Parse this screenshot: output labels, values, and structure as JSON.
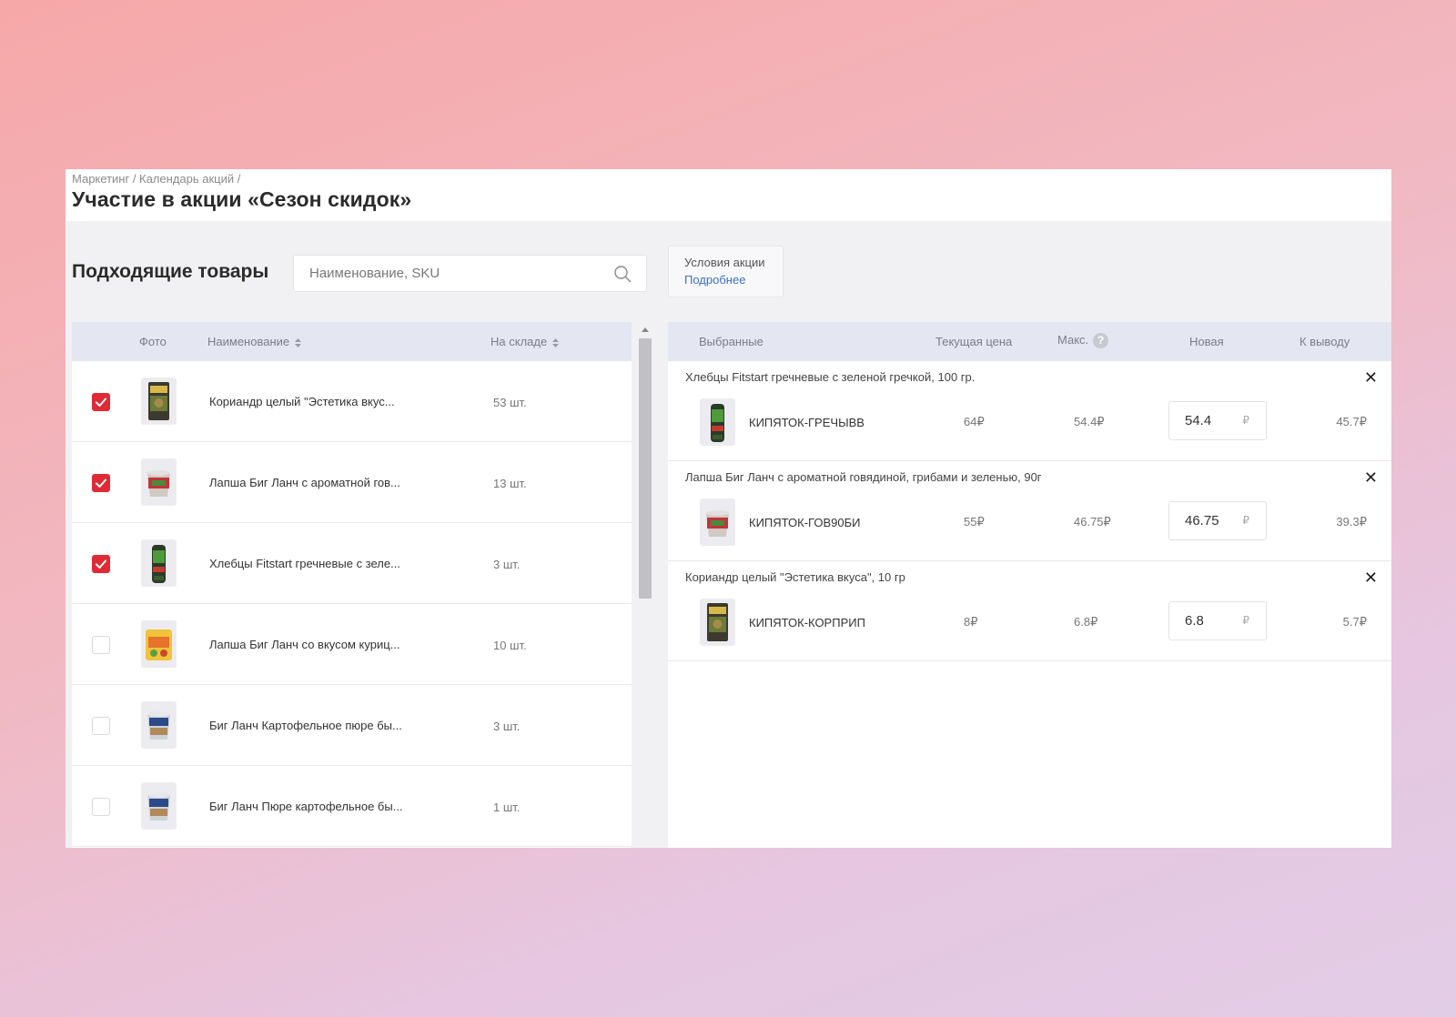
{
  "header": {
    "breadcrumb": "Маркетинг / Календарь акций /",
    "title": "Участие в акции «Сезон скидок»"
  },
  "left": {
    "section_title": "Подходящие товары",
    "search_placeholder": "Наименование, SKU",
    "columns": {
      "photo": "Фото",
      "name": "Наименование",
      "stock": "На складе"
    },
    "rows": [
      {
        "checked": true,
        "name": "Кориандр целый \"Эстетика вкус...",
        "stock": "53 шт.",
        "thumb": "coriander"
      },
      {
        "checked": true,
        "name": "Лапша Биг Ланч с ароматной гов...",
        "stock": "13 шт.",
        "thumb": "cup-red"
      },
      {
        "checked": true,
        "name": "Хлебцы Fitstart гречневые с зеле...",
        "stock": "3 шт.",
        "thumb": "bread"
      },
      {
        "checked": false,
        "name": "Лапша Биг Ланч со вкусом куриц...",
        "stock": "10 шт.",
        "thumb": "noodle-pack"
      },
      {
        "checked": false,
        "name": "Биг Ланч Картофельное пюре бы...",
        "stock": "3 шт.",
        "thumb": "cup-blue"
      },
      {
        "checked": false,
        "name": "Биг Ланч Пюре картофельное бы...",
        "stock": "1 шт.",
        "thumb": "cup-blue"
      }
    ]
  },
  "promo": {
    "line1": "Условия акции",
    "line2": "Подробнее"
  },
  "right": {
    "columns": {
      "selected": "Выбранные",
      "current": "Текущая цена",
      "max": "Макс.",
      "help": "?",
      "new": "Новая",
      "out": "К выводу"
    },
    "currency": "₽",
    "items": [
      {
        "title": "Хлебцы Fitstart гречневые с зеленой гречкой, 100 гр.",
        "sku": "КИПЯТОК-ГРЕЧЫВВ",
        "current": "64₽",
        "max": "54.4₽",
        "new": "54.4",
        "out": "45.7₽",
        "thumb": "bread"
      },
      {
        "title": "Лапша Биг Ланч с ароматной говядиной, грибами и зеленью, 90г",
        "sku": "КИПЯТОК-ГОВ90БИ",
        "current": "55₽",
        "max": "46.75₽",
        "new": "46.75",
        "out": "39.3₽",
        "thumb": "cup-red"
      },
      {
        "title": "Кориандр целый \"Эстетика вкуса\", 10 гр",
        "sku": "КИПЯТОК-КОРПРИП",
        "current": "8₽",
        "max": "6.8₽",
        "new": "6.8",
        "out": "5.7₽",
        "thumb": "coriander"
      }
    ]
  },
  "colors": {
    "accent": "#e02a35",
    "link": "#3a71c7",
    "table_head": "#e4e7f1"
  }
}
